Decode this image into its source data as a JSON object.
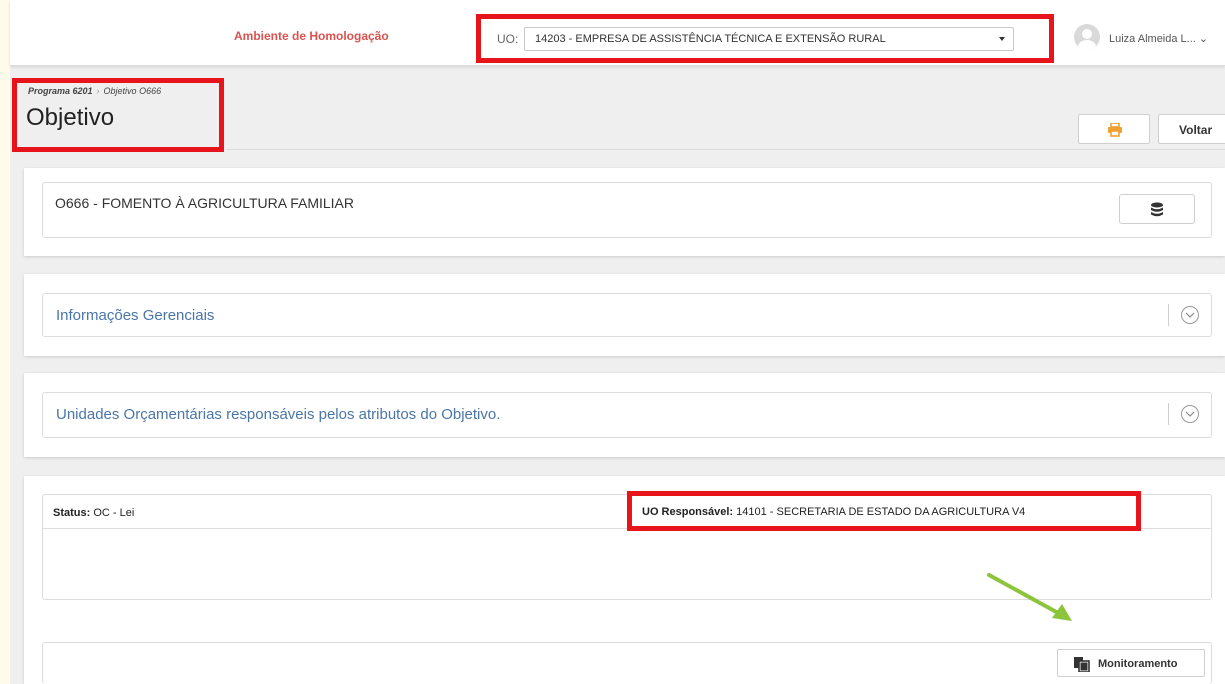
{
  "topbar": {
    "environment_label": "Ambiente de Homologação",
    "uo_label": "UO:",
    "uo_selected": "14203 - EMPRESA DE ASSISTÊNCIA TÉCNICA E EXTENSÃO RURAL",
    "user_name": "Luiza Almeida L...",
    "user_menu_icon": "chevron-down-icon"
  },
  "header": {
    "breadcrumb": [
      "Programa 6201",
      "Objetivo O666"
    ],
    "breadcrumb_separator": "›",
    "title": "Objetivo",
    "print_icon": "printer-icon",
    "back_label": "Voltar"
  },
  "objective": {
    "title": "O666 - FOMENTO À AGRICULTURA FAMILIAR",
    "data_icon": "database-icon"
  },
  "sections": [
    {
      "title": "Informações Gerenciais",
      "icon": "chevron-down-circle-icon"
    },
    {
      "title": "Unidades Orçamentárias responsáveis pelos atributos do Objetivo.",
      "icon": "chevron-down-circle-icon"
    }
  ],
  "status_panel": {
    "status_label": "Status:",
    "status_value": "OC - Lei",
    "uo_resp_label": "UO Responsável:",
    "uo_resp_value": "14101 - SECRETARIA DE ESTADO DA AGRICULTURA V4"
  },
  "monitoring": {
    "button_label": "Monitoramento",
    "button_icon": "copy-icon"
  },
  "colors": {
    "highlight": "#e8141b",
    "environment": "#d9534f",
    "section_title": "#4a76a8",
    "print_icon": "#f0a030",
    "annotation_arrow": "#8cc43c"
  }
}
